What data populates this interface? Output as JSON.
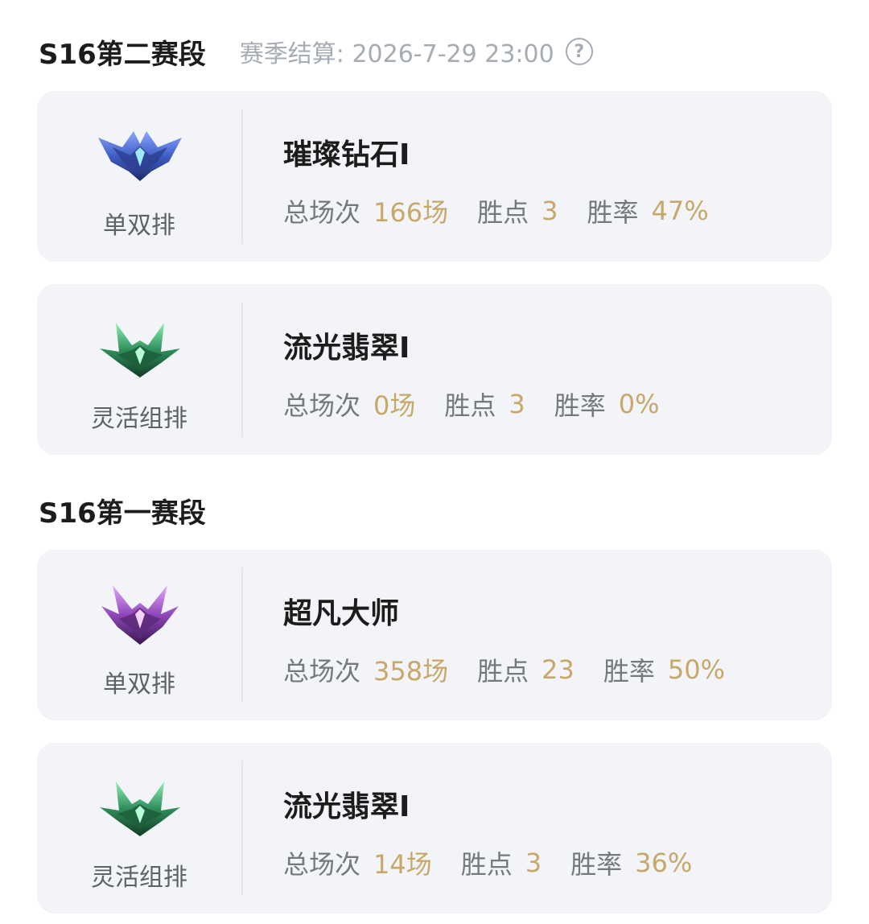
{
  "seasons": [
    {
      "title": "S16第二赛段",
      "settlement": "赛季结算: 2026-7-29 23:00",
      "help_glyph": "?",
      "cards": [
        {
          "queue": "单双排",
          "rank": "璀璨钻石I",
          "emblem_icon": "diamond-rank-emblem-icon",
          "emblem_color": "#3f5fc4",
          "total_label": "总场次",
          "total_value": "166场",
          "lp_label": "胜点",
          "lp_value": "3",
          "winrate_label": "胜率",
          "winrate_value": "47%"
        },
        {
          "queue": "灵活组排",
          "rank": "流光翡翠I",
          "emblem_icon": "emerald-rank-emblem-icon",
          "emblem_color": "#2f8d5a",
          "total_label": "总场次",
          "total_value": "0场",
          "lp_label": "胜点",
          "lp_value": "3",
          "winrate_label": "胜率",
          "winrate_value": "0%"
        }
      ]
    },
    {
      "title": "S16第一赛段",
      "cards": [
        {
          "queue": "单双排",
          "rank": "超凡大师",
          "emblem_icon": "master-rank-emblem-icon",
          "emblem_color": "#8e47b8",
          "total_label": "总场次",
          "total_value": "358场",
          "lp_label": "胜点",
          "lp_value": "23",
          "winrate_label": "胜率",
          "winrate_value": "50%"
        },
        {
          "queue": "灵活组排",
          "rank": "流光翡翠I",
          "emblem_icon": "emerald-rank-emblem-icon",
          "emblem_color": "#2f8d5a",
          "total_label": "总场次",
          "total_value": "14场",
          "lp_label": "胜点",
          "lp_value": "3",
          "winrate_label": "胜率",
          "winrate_value": "36%"
        }
      ]
    }
  ],
  "colors": {
    "card_bg": "#f3f4f7",
    "value_gold": "#c8a86a",
    "label_gray": "#75787d",
    "header_gray": "#a6acb3"
  }
}
